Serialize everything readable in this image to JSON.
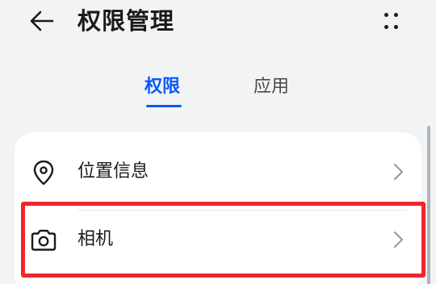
{
  "header": {
    "back_icon": "arrow-left-icon",
    "title": "权限管理",
    "more_icon": "more-dots-icon"
  },
  "tabs": [
    {
      "label": "权限",
      "active": true
    },
    {
      "label": "应用",
      "active": false
    }
  ],
  "permissions": [
    {
      "label": "位置信息",
      "icon": "location-pin-icon"
    },
    {
      "label": "相机",
      "icon": "camera-icon"
    }
  ],
  "colors": {
    "accent": "#0a59f7",
    "highlight": "#f0262b",
    "background": "#f1f3f5",
    "card": "#ffffff"
  }
}
